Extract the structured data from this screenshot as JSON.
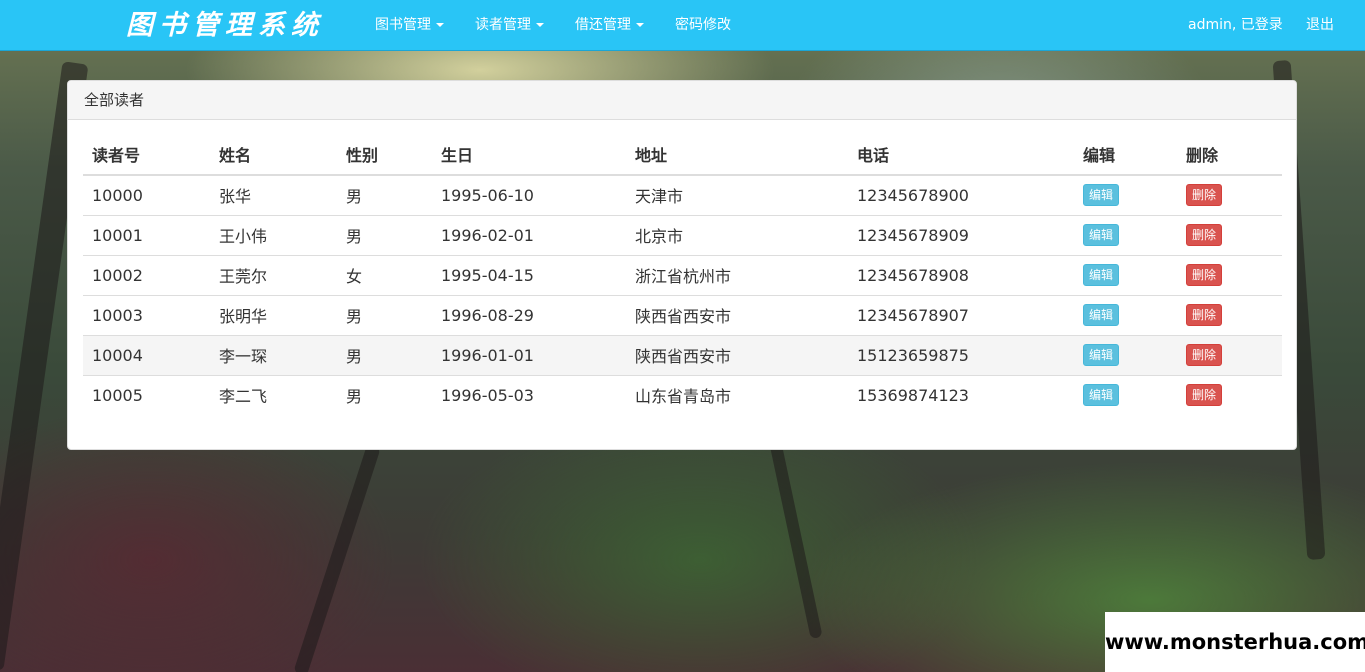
{
  "navbar": {
    "brand": "图书管理系统",
    "menu": [
      {
        "label": "图书管理",
        "has_caret": true
      },
      {
        "label": "读者管理",
        "has_caret": true
      },
      {
        "label": "借还管理",
        "has_caret": true
      },
      {
        "label": "密码修改",
        "has_caret": false
      }
    ],
    "user_status": "admin, 已登录",
    "logout": "退出",
    "color": "#29c5f6"
  },
  "panel": {
    "title": "全部读者",
    "columns": [
      "读者号",
      "姓名",
      "性别",
      "生日",
      "地址",
      "电话",
      "编辑",
      "删除"
    ],
    "rows": [
      {
        "id": "10000",
        "name": "张华",
        "gender": "男",
        "birthday": "1995-06-10",
        "address": "天津市",
        "phone": "12345678900",
        "edit": "编辑",
        "delete": "删除"
      },
      {
        "id": "10001",
        "name": "王小伟",
        "gender": "男",
        "birthday": "1996-02-01",
        "address": "北京市",
        "phone": "12345678909",
        "edit": "编辑",
        "delete": "删除"
      },
      {
        "id": "10002",
        "name": "王莞尔",
        "gender": "女",
        "birthday": "1995-04-15",
        "address": "浙江省杭州市",
        "phone": "12345678908",
        "edit": "编辑",
        "delete": "删除"
      },
      {
        "id": "10003",
        "name": "张明华",
        "gender": "男",
        "birthday": "1996-08-29",
        "address": "陕西省西安市",
        "phone": "12345678907",
        "edit": "编辑",
        "delete": "删除"
      },
      {
        "id": "10004",
        "name": "李一琛",
        "gender": "男",
        "birthday": "1996-01-01",
        "address": "陕西省西安市",
        "phone": "15123659875",
        "edit": "编辑",
        "delete": "删除"
      },
      {
        "id": "10005",
        "name": "李二飞",
        "gender": "男",
        "birthday": "1996-05-03",
        "address": "山东省青岛市",
        "phone": "15369874123",
        "edit": "编辑",
        "delete": "删除"
      }
    ],
    "edit_button_color": "#5bc0de",
    "delete_button_color": "#d9534f"
  },
  "watermark": "www.monsterhua.com"
}
